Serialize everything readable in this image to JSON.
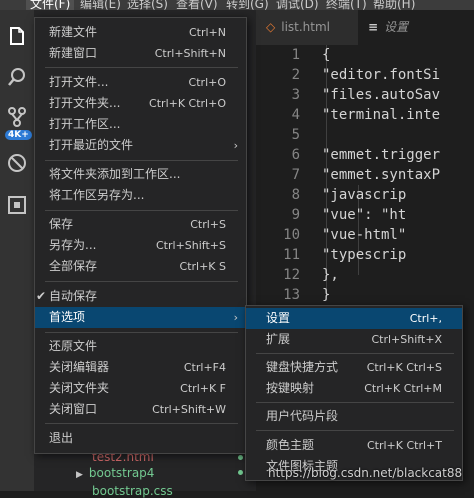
{
  "menubar": {
    "items": [
      "文件(F)",
      "编辑(E)",
      "选择(S)",
      "查看(V)",
      "转到(G)",
      "调试(D)",
      "终端(T)",
      "帮助(H)"
    ]
  },
  "activity": {
    "badge": "4K+"
  },
  "tabs": [
    {
      "label": "list.html",
      "icon": "◇"
    },
    {
      "label": "设置",
      "icon": "≡"
    }
  ],
  "editor": {
    "lines": [
      {
        "n": "1",
        "text": "{"
      },
      {
        "n": "2",
        "text": "    \"editor.fontSi"
      },
      {
        "n": "3",
        "text": "    \"files.autoSav"
      },
      {
        "n": "4",
        "text": "    \"terminal.inte"
      },
      {
        "n": "5",
        "text": ""
      },
      {
        "n": "6",
        "text": "    \"emmet.trigger"
      },
      {
        "n": "7",
        "text": "    \"emmet.syntaxP"
      },
      {
        "n": "8",
        "text": "        \"javascrip"
      },
      {
        "n": "9",
        "text": "        \"vue\": \"ht"
      },
      {
        "n": "10",
        "text": "        \"vue-html\""
      },
      {
        "n": "11",
        "text": "        \"typescrip"
      },
      {
        "n": "12",
        "text": "    },"
      },
      {
        "n": "13",
        "text": "}"
      }
    ]
  },
  "file_menu": {
    "items": [
      {
        "label": "新建文件",
        "shortcut": "Ctrl+N"
      },
      {
        "label": "新建窗口",
        "shortcut": "Ctrl+Shift+N"
      },
      {
        "label": "打开文件...",
        "shortcut": "Ctrl+O"
      },
      {
        "label": "打开文件夹...",
        "shortcut": "Ctrl+K Ctrl+O"
      },
      {
        "label": "打开工作区...",
        "shortcut": ""
      },
      {
        "label": "打开最近的文件",
        "shortcut": ""
      },
      {
        "label": "将文件夹添加到工作区...",
        "shortcut": ""
      },
      {
        "label": "将工作区另存为...",
        "shortcut": ""
      },
      {
        "label": "保存",
        "shortcut": "Ctrl+S"
      },
      {
        "label": "另存为...",
        "shortcut": "Ctrl+Shift+S"
      },
      {
        "label": "全部保存",
        "shortcut": "Ctrl+K S"
      },
      {
        "label": "自动保存",
        "shortcut": ""
      },
      {
        "label": "首选项",
        "shortcut": ""
      },
      {
        "label": "还原文件",
        "shortcut": ""
      },
      {
        "label": "关闭编辑器",
        "shortcut": "Ctrl+F4"
      },
      {
        "label": "关闭文件夹",
        "shortcut": "Ctrl+K F"
      },
      {
        "label": "关闭窗口",
        "shortcut": "Ctrl+Shift+W"
      },
      {
        "label": "退出",
        "shortcut": ""
      }
    ]
  },
  "pref_menu": {
    "items": [
      {
        "label": "设置",
        "shortcut": "Ctrl+,"
      },
      {
        "label": "扩展",
        "shortcut": "Ctrl+Shift+X"
      },
      {
        "label": "键盘快捷方式",
        "shortcut": "Ctrl+K Ctrl+S"
      },
      {
        "label": "按键映射",
        "shortcut": "Ctrl+K Ctrl+M"
      },
      {
        "label": "用户代码片段",
        "shortcut": ""
      },
      {
        "label": "颜色主题",
        "shortcut": "Ctrl+K Ctrl+T"
      },
      {
        "label": "文件图标主题",
        "shortcut": ""
      }
    ]
  },
  "explorer": {
    "items": [
      {
        "label": "test2.html"
      },
      {
        "label": "bootstrap4"
      },
      {
        "label": "bootstrap.css"
      }
    ]
  },
  "watermark": "https://blog.csdn.net/blackcat88"
}
